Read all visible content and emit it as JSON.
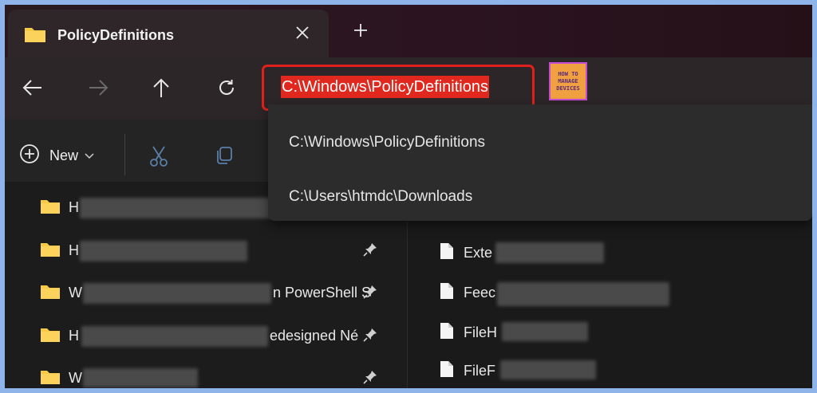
{
  "window": {
    "tab_title": "PolicyDefinitions",
    "tab_icon": "folder-icon",
    "new_tab_label": "+"
  },
  "navigation": {
    "back_icon": "arrow-left-icon",
    "forward_icon": "arrow-right-icon",
    "up_icon": "arrow-up-icon",
    "refresh_icon": "refresh-icon",
    "address_value": "C:\\Windows\\PolicyDefinitions"
  },
  "logo": {
    "line1": "HOW TO",
    "line2": "MANAGE",
    "line3": "DEVICES"
  },
  "toolbar": {
    "new_label": "New",
    "cut_icon": "scissors-icon",
    "copy_icon": "copy-icon"
  },
  "address_suggestions": [
    "C:\\Windows\\PolicyDefinitions",
    "C:\\Users\\htmdc\\Downloads"
  ],
  "left_pane": {
    "items": [
      {
        "text": "H",
        "pinned": false
      },
      {
        "text": "H",
        "pinned": true
      },
      {
        "text": "W",
        "suffix": "n PowerShell S",
        "pinned": true
      },
      {
        "text": "H",
        "suffix": "edesigned Né",
        "pinned": true
      },
      {
        "text": "W",
        "pinned": true
      }
    ]
  },
  "right_pane": {
    "files": [
      {
        "text": "Exte"
      },
      {
        "text": "Feec"
      },
      {
        "text": "FileH"
      },
      {
        "text": "FileF"
      }
    ]
  },
  "colors": {
    "accent": "#e0281e",
    "folder": "#f7c948",
    "background": "#1c1c1c"
  }
}
